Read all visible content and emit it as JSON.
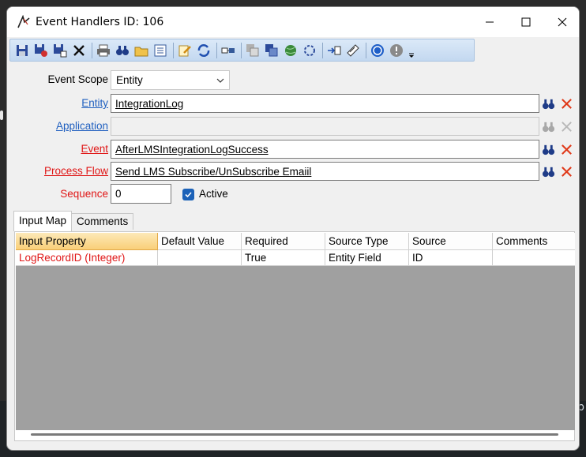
{
  "window": {
    "title": "Event Handlers ID: 106"
  },
  "toolbar": {
    "icons": [
      "save-icon",
      "save-close-icon",
      "save-new-icon",
      "delete-icon",
      "print-icon",
      "find-icon",
      "open-folder-icon",
      "list-icon",
      "edit-icon",
      "refresh-icon",
      "link-icon",
      "copy-icon",
      "new-window-icon",
      "globe-icon",
      "settings-icon",
      "export-icon",
      "note-icon",
      "help-icon",
      "info-icon",
      "overflow-icon"
    ]
  },
  "form": {
    "event_scope_label": "Event Scope",
    "event_scope_value": "Entity",
    "entity_label": "Entity",
    "entity_value": "IntegrationLog",
    "application_label": "Application",
    "application_value": "",
    "event_label": "Event",
    "event_value": "AfterLMSIntegrationLogSuccess",
    "process_flow_label": "Process Flow",
    "process_flow_value": "Send LMS Subscribe/UnSubscribe Emaiil",
    "sequence_label": "Sequence",
    "sequence_value": "0",
    "active_label": "Active",
    "active_checked": true
  },
  "tabs": [
    {
      "label": "Input Map",
      "active": true
    },
    {
      "label": "Comments",
      "active": false
    }
  ],
  "grid": {
    "columns": [
      "Input Property",
      "Default Value",
      "Required",
      "Source Type",
      "Source",
      "Comments"
    ],
    "rows": [
      [
        "LogRecordID (Integer)",
        "",
        "True",
        "Entity Field",
        "ID",
        ""
      ]
    ]
  },
  "background": {
    "partial_letter": "p"
  }
}
